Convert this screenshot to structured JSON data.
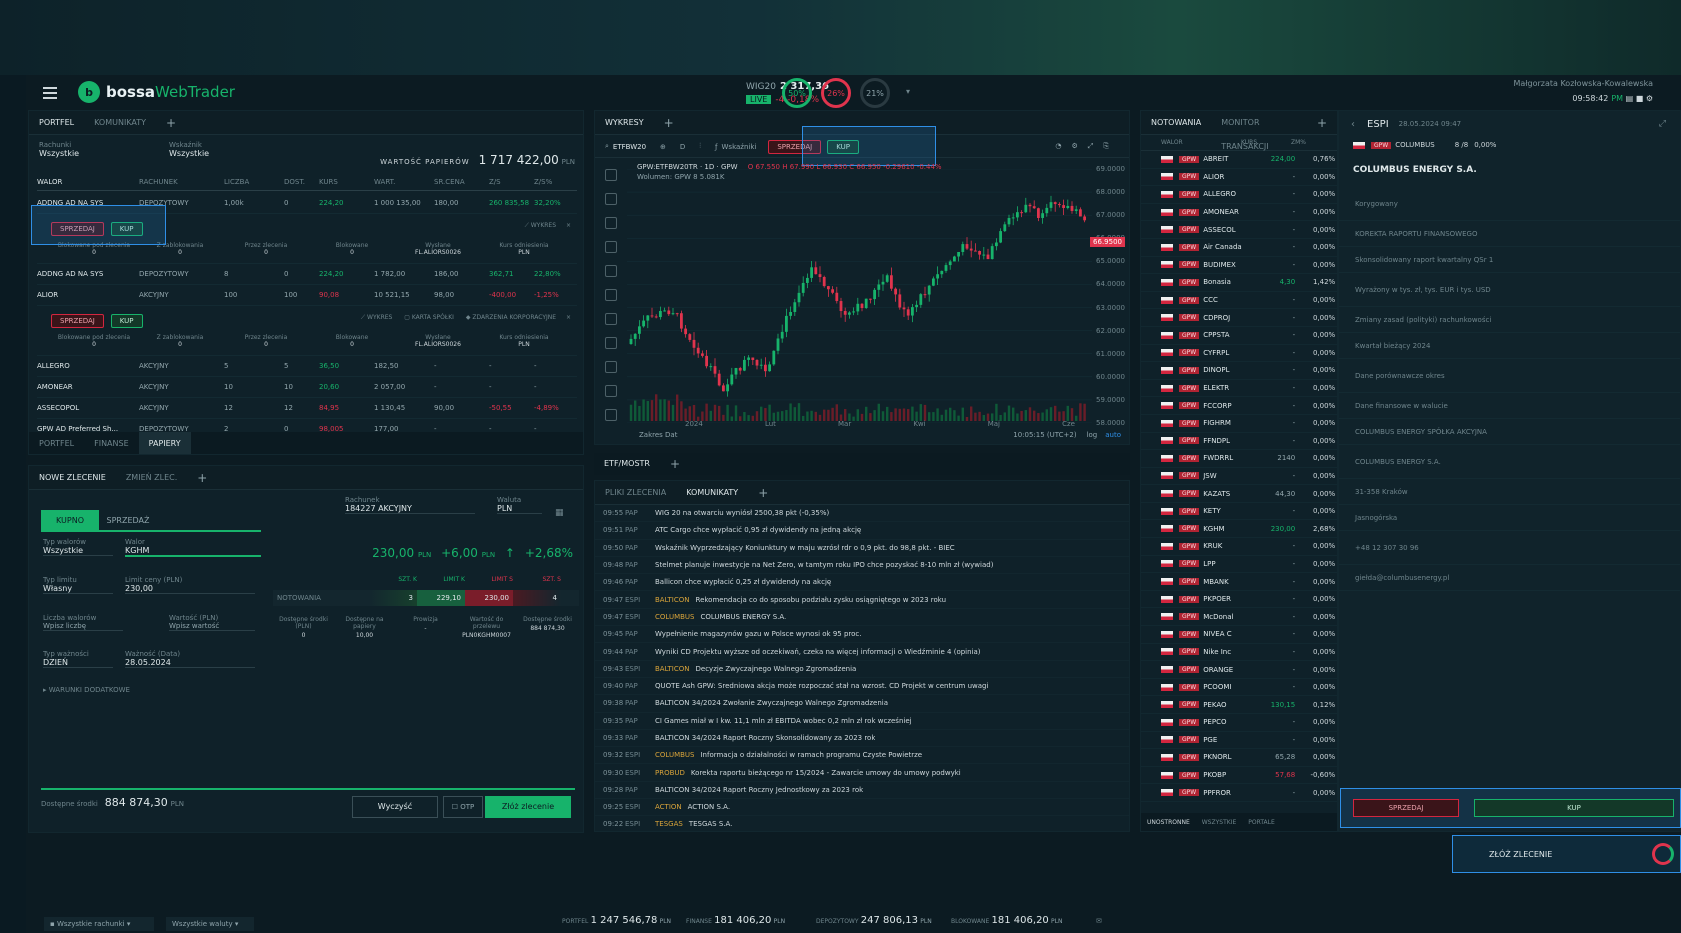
{
  "header": {
    "logo_text": "bossa",
    "logo_text2": "WebTrader",
    "index_name": "WIG20",
    "index_value": "2 317,36",
    "index_change": "-4 -0,18%",
    "index_badge": "LIVE",
    "gauges": [
      "50%",
      "26%",
      "21%"
    ],
    "user": "Małgorzata Kozłowska-Kowalewska",
    "time": "09:58:42",
    "time_suffix": "PM"
  },
  "portfolio": {
    "tabs": [
      "PORTFEL",
      "KOMUNIKATY"
    ],
    "filter1_label": "Rachunki",
    "filter1_value": "Wszystkie",
    "filter2_label": "Wskaźnik",
    "filter2_value": "Wszystkie",
    "summary_label": "WARTOŚĆ PAPIERÓW",
    "summary_value": "1 717 422,00",
    "summary_currency": "PLN",
    "columns": [
      "WALOR",
      "RACHUNEK",
      "LICZBA",
      "DOST.",
      "KURS",
      "WART.",
      "ŚR.CENA",
      "Z/S",
      "Z/S%"
    ],
    "rows": [
      {
        "name": "ADDNG AD NA SYS",
        "account": "DEPOZYTOWY",
        "qty": "1,00k",
        "avail": "0",
        "price": "224,20",
        "value": "1 000 135,00",
        "avg": "180,00",
        "pl": "260 835,58",
        "plp": "32,20%",
        "pos": true
      },
      {
        "name": "ADDNG AD NA SYS",
        "account": "DEPOZYTOWY",
        "qty": "8",
        "avail": "0",
        "price": "224,20",
        "value": "1 782,00",
        "avg": "186,00",
        "pl": "362,71",
        "plp": "22,80%",
        "pos": true
      },
      {
        "name": "ALIOR",
        "account": "AKCYJNY",
        "qty": "100",
        "avail": "100",
        "price": "90,08",
        "value": "10 521,15",
        "avg": "98,00",
        "pl": "-400,00",
        "plp": "-1,25%",
        "pos": false
      },
      {
        "name": "ALLEGRO",
        "account": "AKCYJNY",
        "qty": "5",
        "avail": "5",
        "price": "36,50",
        "value": "182,50",
        "avg": "-",
        "pl": "-",
        "plp": "-",
        "pos": true
      },
      {
        "name": "AMONEAR",
        "account": "AKCYJNY",
        "qty": "10",
        "avail": "10",
        "price": "20,60",
        "value": "2 057,00",
        "avg": "-",
        "pl": "-",
        "plp": "-",
        "pos": true
      },
      {
        "name": "ASSECOPOL",
        "account": "AKCYJNY",
        "qty": "12",
        "avail": "12",
        "price": "84,95",
        "value": "1 130,45",
        "avg": "90,00",
        "pl": "-50,55",
        "plp": "-4,89%",
        "pos": false
      },
      {
        "name": "GPW AD Preferred Sh...",
        "account": "DEPOZYTOWY",
        "qty": "2",
        "avail": "0",
        "price": "98,005",
        "value": "177,00",
        "avg": "-",
        "pl": "-",
        "plp": "-",
        "pos": false
      }
    ],
    "sell": "SPRZEDAJ",
    "buy": "KUP",
    "detail_labels": [
      "Blokowane pod zlecenia",
      "Z zablokowania",
      "Przez zlecenia",
      "Blokowane",
      "Wysłane",
      "Kurs odniesienia"
    ],
    "detail_values": [
      "0",
      "0",
      "0",
      "0",
      "FL.ALIORS0026",
      "PLN"
    ],
    "detail_actions": [
      "WYKRES",
      "KARTA SPÓŁKI",
      "ZDARZENIA KORPORACYJNE"
    ],
    "bottom_tabs": [
      "PORTFEL",
      "FINANSE",
      "PAPIERY"
    ]
  },
  "order": {
    "tabs": [
      "NOWE ZLECENIE",
      "ZMIEŃ ZLEC."
    ],
    "buy_tab": "KUPNO",
    "sell_tab": "SPRZEDAŻ",
    "account_label": "Rachunek",
    "account_value": "184227 AKCYJNY",
    "currency_label": "Waluta",
    "currency_value": "PLN",
    "type_label": "Typ walorów",
    "type_value": "Wszystkie",
    "symbol_label": "Walor",
    "symbol_value": "KGHM",
    "price_big": "230,00",
    "price_cur": "PLN",
    "change_abs": "+6,00",
    "change_cur": "PLN",
    "change_pct": "+2,68%",
    "order_type_label": "Typ limitu",
    "order_type_value": "Własny",
    "limit_label": "Limit ceny (PLN)",
    "limit_value": "230,00",
    "qty_label": "Liczba walorów",
    "qty_value": "Wpisz liczbę",
    "value_label": "Wartość (PLN)",
    "value_value": "Wpisz wartość",
    "validity_label": "Typ ważności",
    "validity_value": "DZIEŃ",
    "date_label": "Ważność (Data)",
    "date_value": "28.05.2024",
    "adv_label": "WARUNKI DODATKOWE",
    "book_label": "NOTOWANIA",
    "book_headers": [
      "SZT. K",
      "LIMIT K",
      "LIMIT S",
      "SZT. S"
    ],
    "book_values": [
      "3",
      "229,10",
      "230,00",
      "4"
    ],
    "info_labels": [
      "Dostępne środki (PLN)",
      "Dostępne na papiery",
      "Prowizja",
      "Wartość do przelewu",
      "Dostępne środki"
    ],
    "info_values": [
      "0",
      "10,00",
      "-",
      "PLN0KGHM0007",
      "884 874,30"
    ],
    "info_currency": "PLN",
    "available_label": "Dostępne środki",
    "available_value": "884 874,30",
    "available_cur": "PLN",
    "clear_btn": "Wyczyść",
    "submit_btn": "Złóż zlecenie",
    "otp": "OTP"
  },
  "chart": {
    "tabs": [
      "WYKRESY"
    ],
    "symbol": "ETFBW20",
    "interval": "D",
    "title": "GPW:ETFBW20TR · 1D · GPW",
    "ohlc": "O 67.550  H 67.990  L 66.930  C 66.950  -0.29610 -0.44%",
    "volume": "Wolumen: GPW 8  5.081K",
    "indicators_label": "Wskaźniki",
    "sell": "SPRZEDAJ",
    "buy": "KUP",
    "y_ticks": [
      "69.0000",
      "68.0000",
      "67.0000",
      "66.0000",
      "65.0000",
      "64.0000",
      "63.0000",
      "62.0000",
      "61.0000",
      "60.0000",
      "59.0000",
      "58.0000"
    ],
    "last_price": "66.9500",
    "x_ticks": [
      "2024",
      "Lut",
      "Mar",
      "Kwi",
      "Maj",
      "Cze"
    ],
    "range_label": "Zakres Dat",
    "clock": "10:05:15 (UTC+2)",
    "log_label": "log",
    "auto_label": "auto",
    "bottom_tabs": [
      "ETF/MOSTR"
    ]
  },
  "news": {
    "tabs": [
      "PLIKI ZLECENIA",
      "KOMUNIKATY"
    ],
    "rows": [
      {
        "t": "09:55",
        "s": "PAP",
        "tag": "",
        "h": "WIG 20 na otwarciu wyniósł 2500,38 pkt (-0,35%)"
      },
      {
        "t": "09:51",
        "s": "PAP",
        "tag": "",
        "h": "ATC Cargo chce wypłacić 0,95 zł dywidendy na jedną akcję"
      },
      {
        "t": "09:50",
        "s": "PAP",
        "tag": "",
        "h": "Wskaźnik Wyprzedzający Koniunktury w maju wzrósł rdr o 0,9 pkt. do 98,8 pkt. - BIEC"
      },
      {
        "t": "09:48",
        "s": "PAP",
        "tag": "",
        "h": "Stelmet planuje inwestycje na Net Zero, w tamtym roku IPO chce pozyskać 8-10 mln zł (wywiad)"
      },
      {
        "t": "09:46",
        "s": "PAP",
        "tag": "",
        "h": "Ballicon chce wypłacić 0,25 zł dywidendy na akcję"
      },
      {
        "t": "09:47",
        "s": "ESPI",
        "tag": "BALTICON",
        "h": "Rekomendacja co do sposobu podziału zysku osiągniętego w 2023 roku"
      },
      {
        "t": "09:47",
        "s": "ESPI",
        "tag": "COLUMBUS",
        "h": "COLUMBUS ENERGY S.A."
      },
      {
        "t": "09:45",
        "s": "PAP",
        "tag": "",
        "h": "Wypełnienie magazynów gazu w Polsce wynosi ok 95 proc."
      },
      {
        "t": "09:44",
        "s": "PAP",
        "tag": "",
        "h": "Wyniki CD Projektu wyższe od oczekiwań, czeka na więcej informacji o Wiedźminie 4 (opinia)"
      },
      {
        "t": "09:43",
        "s": "ESPI",
        "tag": "BALTICON",
        "h": "Decyzje Zwyczajnego Walnego Zgromadzenia"
      },
      {
        "t": "09:40",
        "s": "PAP",
        "tag": "",
        "h": "QUOTE Ash GPW: Sredniowa akcja może rozpoczać stał na wzrost. CD Projekt w centrum uwagi"
      },
      {
        "t": "09:38",
        "s": "PAP",
        "tag": "",
        "h": "BALTICON 34/2024 Zwołanie Zwyczajnego Walnego Zgromadzenia"
      },
      {
        "t": "09:35",
        "s": "PAP",
        "tag": "",
        "h": "CI Games miał w I kw. 11,1 mln zł EBITDA wobec 0,2 mln zł rok wcześniej"
      },
      {
        "t": "09:33",
        "s": "PAP",
        "tag": "",
        "h": "BALTICON 34/2024 Raport Roczny Skonsolidowany za 2023 rok"
      },
      {
        "t": "09:32",
        "s": "ESPI",
        "tag": "COLUMBUS",
        "h": "Informacja o działalności w ramach programu Czyste Powietrze"
      },
      {
        "t": "09:30",
        "s": "ESPI",
        "tag": "PROBUD",
        "h": "Korekta raportu bieżącego nr 15/2024 - Zawarcie umowy do umowy podwyki"
      },
      {
        "t": "09:28",
        "s": "PAP",
        "tag": "",
        "h": "BALTICON 34/2024 Raport Roczny Jednostkowy za 2023 rok"
      },
      {
        "t": "09:25",
        "s": "ESPI",
        "tag": "ACTION",
        "h": "ACTION S.A."
      },
      {
        "t": "09:22",
        "s": "ESPI",
        "tag": "TESGAS",
        "h": "TESGAS S.A."
      }
    ]
  },
  "watchlist": {
    "tabs": [
      "NOTOWANIA",
      "MONITOR TRANSAKCJI"
    ],
    "columns": [
      "WALOR",
      "KURS",
      "ZM%"
    ],
    "rows": [
      {
        "n": "ABREIT",
        "v": "224,00",
        "c": "0,76%"
      },
      {
        "n": "ALIOR",
        "v": "-",
        "c": "0,00%"
      },
      {
        "n": "ALLEGRO",
        "v": "-",
        "c": "0,00%"
      },
      {
        "n": "AMONEAR",
        "v": "-",
        "c": "0,00%"
      },
      {
        "n": "ASSECOL",
        "v": "-",
        "c": "0,00%"
      },
      {
        "n": "Air Canada",
        "v": "-",
        "c": "0,00%"
      },
      {
        "n": "BUDIMEX",
        "v": "-",
        "c": "0,00%"
      },
      {
        "n": "Bonasia",
        "v": "4,30",
        "c": "1,42%"
      },
      {
        "n": "CCC",
        "v": "-",
        "c": "0,00%"
      },
      {
        "n": "CDPROJ",
        "v": "-",
        "c": "0,00%"
      },
      {
        "n": "CPPSTA",
        "v": "-",
        "c": "0,00%"
      },
      {
        "n": "CYFRPL",
        "v": "-",
        "c": "0,00%"
      },
      {
        "n": "DINOPL",
        "v": "-",
        "c": "0,00%"
      },
      {
        "n": "ELEKTR",
        "v": "-",
        "c": "0,00%"
      },
      {
        "n": "FCCORP",
        "v": "-",
        "c": "0,00%"
      },
      {
        "n": "FIGHRM",
        "v": "-",
        "c": "0,00%"
      },
      {
        "n": "FFNDPL",
        "v": "-",
        "c": "0,00%"
      },
      {
        "n": "FWDRRL",
        "v": "2140",
        "c": "0,00%"
      },
      {
        "n": "JSW",
        "v": "-",
        "c": "0,00%"
      },
      {
        "n": "KAZATS",
        "v": "44,30",
        "c": "0,00%"
      },
      {
        "n": "KETY",
        "v": "-",
        "c": "0,00%"
      },
      {
        "n": "KGHM",
        "v": "230,00",
        "c": "2,68%"
      },
      {
        "n": "KRUK",
        "v": "-",
        "c": "0,00%"
      },
      {
        "n": "LPP",
        "v": "-",
        "c": "0,00%"
      },
      {
        "n": "MBANK",
        "v": "-",
        "c": "0,00%"
      },
      {
        "n": "PKPOER",
        "v": "-",
        "c": "0,00%"
      },
      {
        "n": "McDonal",
        "v": "-",
        "c": "0,00%"
      },
      {
        "n": "NIVEA C",
        "v": "-",
        "c": "0,00%"
      },
      {
        "n": "Nike Inc",
        "v": "-",
        "c": "0,00%"
      },
      {
        "n": "ORANGE",
        "v": "-",
        "c": "0,00%"
      },
      {
        "n": "PCOOMI",
        "v": "-",
        "c": "0,00%"
      },
      {
        "n": "PEKAO",
        "v": "130,15",
        "c": "0,12%"
      },
      {
        "n": "PEPCO",
        "v": "-",
        "c": "0,00%"
      },
      {
        "n": "PGE",
        "v": "-",
        "c": "0,00%"
      },
      {
        "n": "PKNORL",
        "v": "65,28",
        "c": "0,00%"
      },
      {
        "n": "PKOBP",
        "v": "57,68",
        "c": "-0,60%"
      },
      {
        "n": "PPFROR",
        "v": "-",
        "c": "0,00%"
      }
    ],
    "bottom_tabs": [
      "UNOSTRONNE",
      "WSZYSTKIE",
      "PORTALE"
    ]
  },
  "company": {
    "source": "ESPI",
    "date": "28.05.2024 09:47",
    "ticker": "COLUMBUS",
    "nr": "8 /8",
    "pct": "0,00%",
    "name": "COLUMBUS ENERGY S.A.",
    "lines": [
      "Korygowany",
      "KOREKTA RAPORTU FINANSOWEGO",
      "Skonsolidowany raport kwartalny QSr 1",
      "Wyrażony w tys. zł, tys. EUR i tys. USD",
      "Zmiany zasad (polityki) rachunkowości",
      "Kwartał bieżący 2024",
      "Dane porównawcze okres",
      "Dane finansowe w walucie",
      "COLUMBUS ENERGY SPÓŁKA AKCYJNA",
      "COLUMBUS ENERGY S.A.",
      "31-358 Kraków",
      "Jasnogórska",
      "+48 12 307 30 96",
      "giełda@columbusenergy.pl"
    ],
    "sell": "SPRZEDAJ",
    "buy": "KUP",
    "submit": "ZŁÓŻ ZLECENIE"
  },
  "statusbar": {
    "accounts": "Wszystkie rachunki",
    "currencies": "Wszystkie waluty",
    "portfolio_label": "PORTFEL",
    "portfolio_value": "1 247 546,78",
    "finance_label": "FINANSE",
    "finance_value": "181 406,20",
    "deposit_label": "DEPOZYTOWY",
    "deposit_value": "247 806,13",
    "blocked_label": "BLOKOWANE",
    "blocked_value": "181 406,20",
    "currency": "PLN"
  }
}
